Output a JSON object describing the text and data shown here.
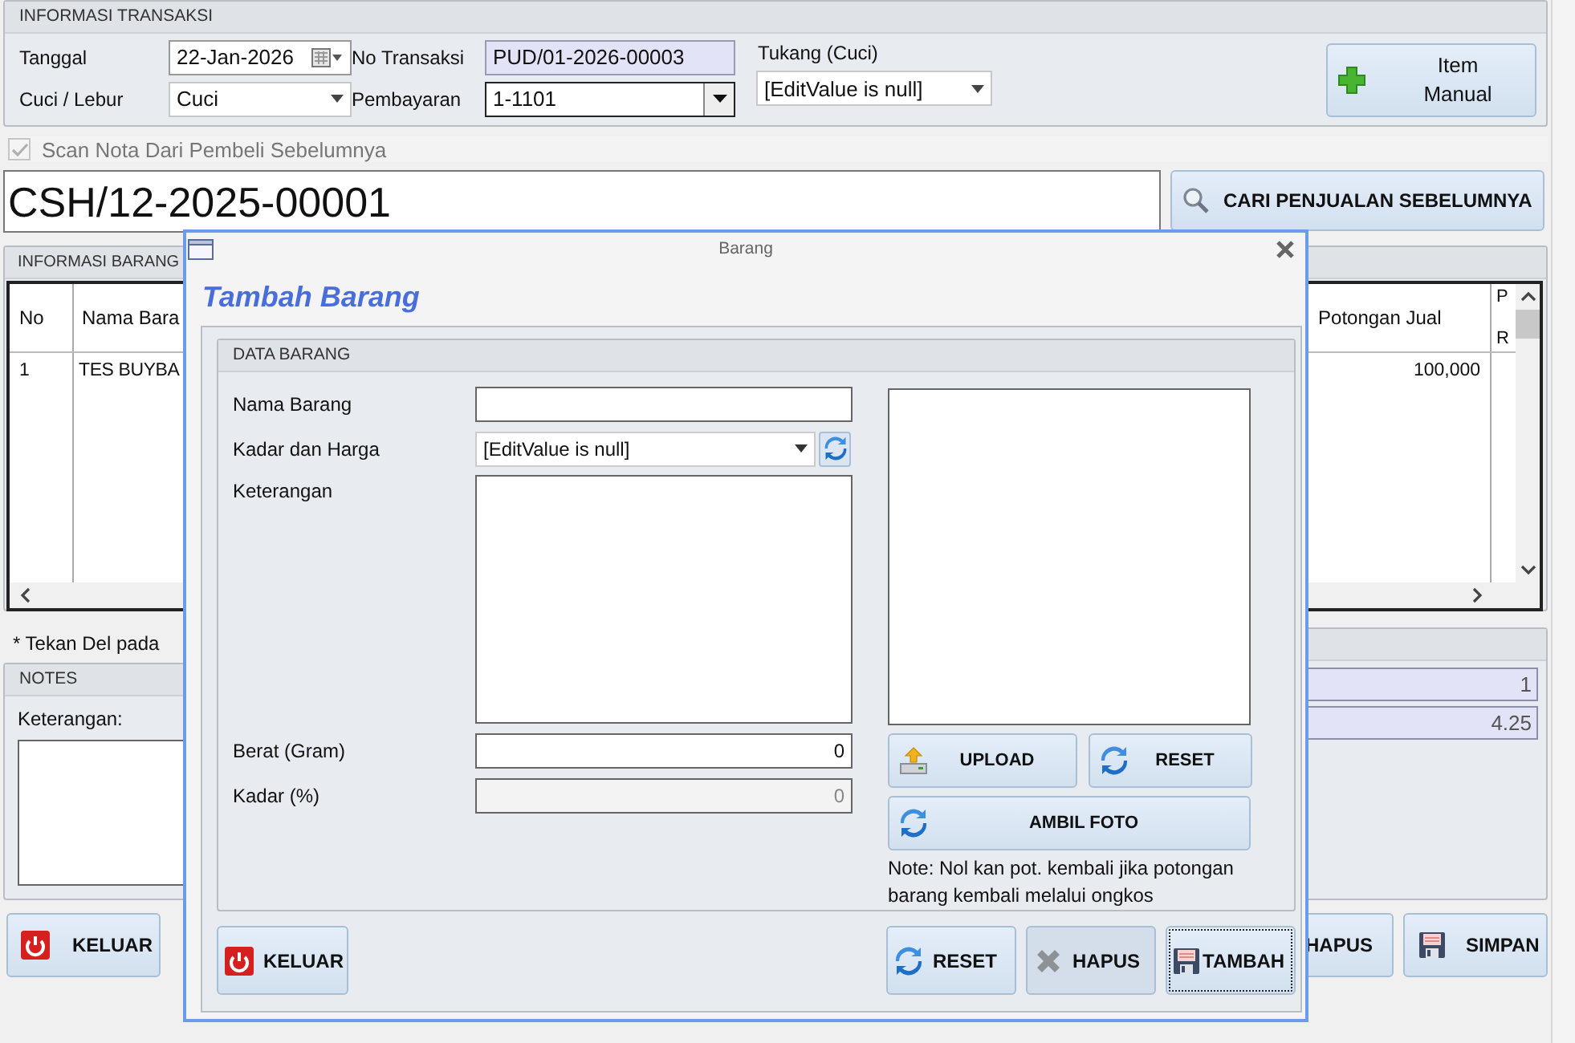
{
  "transaction": {
    "title": "INFORMASI TRANSAKSI",
    "fields": [
      {
        "label": "Tanggal",
        "value": "22-Jan-2026",
        "kind": "date",
        "focused": false
      },
      {
        "label": "No Transaksi",
        "value": "PUD/01-2026-00003",
        "kind": "readonly",
        "focused": false
      },
      {
        "label": "Cuci / Lebur",
        "value": "Cuci",
        "kind": "combo",
        "focused": false
      },
      {
        "label": "Pembayaran",
        "value": "1-1101",
        "kind": "combo",
        "focused": true
      }
    ],
    "tukang": {
      "label": "Tukang (Cuci)",
      "value": "[EditValue is null]"
    },
    "item_manual_button": {
      "label": "Item Manual"
    }
  },
  "scan": {
    "label": "Scan Nota Dari Pembeli Sebelumnya",
    "checked": true,
    "disabled": true
  },
  "nota_field": {
    "value": "CSH/12-2025-00001"
  },
  "search_button": {
    "label": "CARI PENJUALAN SEBELUMNYA"
  },
  "items": {
    "title": "INFORMASI BARANG",
    "columns": [
      "No",
      "Nama Bara",
      "Potongan Jual",
      "P R"
    ],
    "rows": [
      {
        "cells": [
          "1",
          "TES BUYBA",
          "100,000"
        ]
      }
    ]
  },
  "hint": "* Tekan Del pada",
  "notes": {
    "title": "NOTES",
    "label": "Keterangan:"
  },
  "summary": {
    "values": [
      "1",
      "4.25"
    ]
  },
  "bottom_buttons": [
    {
      "label": "KELUAR",
      "kind": "exit"
    },
    {
      "label": "HAPUS",
      "kind": "delete"
    },
    {
      "label": "SIMPAN",
      "kind": "save"
    }
  ],
  "dialog": {
    "title": "Barang",
    "heading": "Tambah Barang",
    "group": "DATA BARANG",
    "fields": [
      {
        "label": "Nama Barang",
        "kind": "text",
        "disabled": false
      },
      {
        "label": "Kadar dan Harga",
        "kind": "combo",
        "value": "[EditValue is null]",
        "disabled": false
      },
      {
        "label": "Keterangan",
        "kind": "memo",
        "disabled": false
      },
      {
        "label": "Berat (Gram)",
        "kind": "number",
        "value": "0",
        "disabled": false
      },
      {
        "label": "Kadar (%)",
        "kind": "number",
        "value": "0",
        "disabled": true
      }
    ],
    "photo_buttons": [
      {
        "label": "UPLOAD",
        "kind": "upload"
      },
      {
        "label": "RESET",
        "kind": "refresh"
      },
      {
        "label": "AMBIL FOTO",
        "kind": "refresh"
      }
    ],
    "note": "Note: Nol kan pot. kembali jika potongan barang kembali melalui ongkos",
    "footer_buttons": [
      {
        "label": "KELUAR",
        "kind": "exit",
        "focused": false
      },
      {
        "label": "RESET",
        "kind": "refresh",
        "focused": false
      },
      {
        "label": "HAPUS",
        "kind": "delete",
        "focused": false
      },
      {
        "label": "TAMBAH",
        "kind": "save",
        "focused": true
      }
    ]
  }
}
